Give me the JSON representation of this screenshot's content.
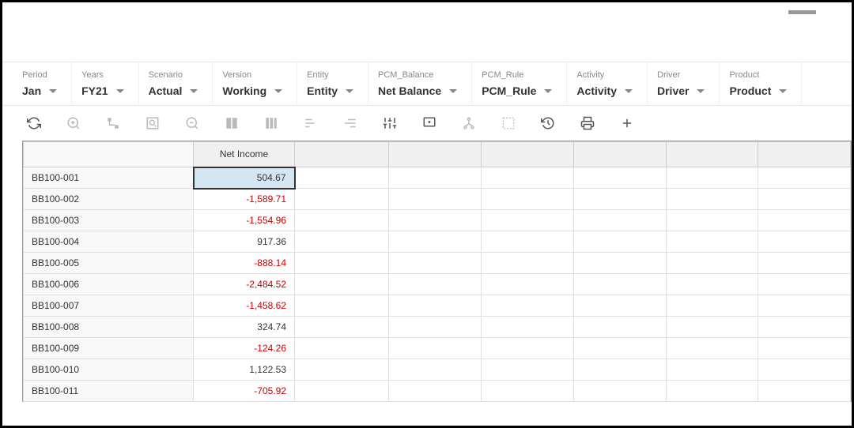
{
  "filters": [
    {
      "label": "Period",
      "value": "Jan"
    },
    {
      "label": "Years",
      "value": "FY21"
    },
    {
      "label": "Scenario",
      "value": "Actual"
    },
    {
      "label": "Version",
      "value": "Working"
    },
    {
      "label": "Entity",
      "value": "Entity"
    },
    {
      "label": "PCM_Balance",
      "value": "Net Balance"
    },
    {
      "label": "PCM_Rule",
      "value": "PCM_Rule"
    },
    {
      "label": "Activity",
      "value": "Activity"
    },
    {
      "label": "Driver",
      "value": "Driver"
    },
    {
      "label": "Product",
      "value": "Product"
    }
  ],
  "columns": [
    "",
    "Net Income",
    "",
    "",
    "",
    "",
    "",
    ""
  ],
  "rows": [
    {
      "label": "BB100-001",
      "value": "504.67",
      "negative": false,
      "selected": true
    },
    {
      "label": "BB100-002",
      "value": "-1,589.71",
      "negative": true,
      "selected": false
    },
    {
      "label": "BB100-003",
      "value": "-1,554.96",
      "negative": true,
      "selected": false
    },
    {
      "label": "BB100-004",
      "value": "917.36",
      "negative": false,
      "selected": false
    },
    {
      "label": "BB100-005",
      "value": "-888.14",
      "negative": true,
      "selected": false
    },
    {
      "label": "BB100-006",
      "value": "-2,484.52",
      "negative": true,
      "selected": false
    },
    {
      "label": "BB100-007",
      "value": "-1,458.62",
      "negative": true,
      "selected": false
    },
    {
      "label": "BB100-008",
      "value": "324.74",
      "negative": false,
      "selected": false
    },
    {
      "label": "BB100-009",
      "value": "-124.26",
      "negative": true,
      "selected": false
    },
    {
      "label": "BB100-010",
      "value": "1,122.53",
      "negative": false,
      "selected": false
    },
    {
      "label": "BB100-011",
      "value": "-705.92",
      "negative": true,
      "selected": false
    }
  ]
}
